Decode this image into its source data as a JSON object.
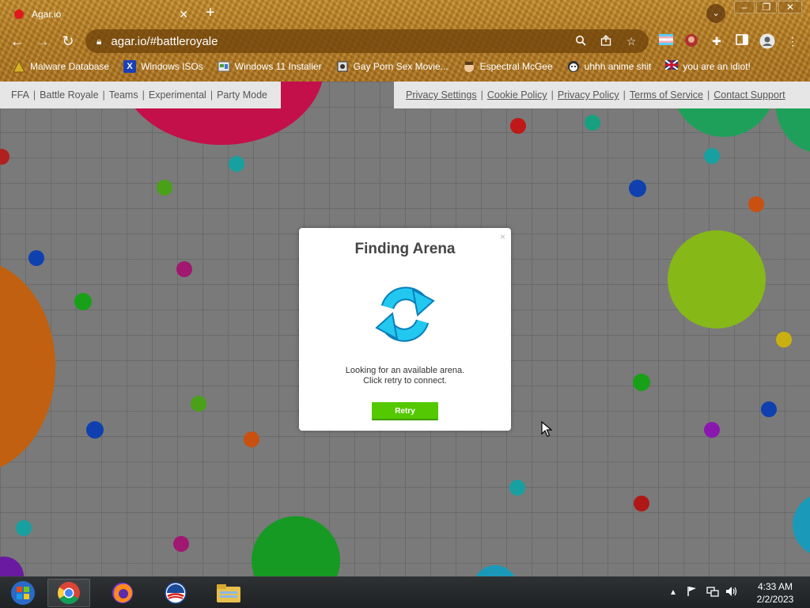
{
  "browser": {
    "tab": {
      "title": "Agar.io",
      "favicon_color": "#e0181e"
    },
    "url": "agar.io/#battleroyale",
    "bookmarks": [
      {
        "label": "Malware Database",
        "icon": "malware-icon"
      },
      {
        "label": "Windows ISOs",
        "icon": "x-icon"
      },
      {
        "label": "Windows 11 Installer",
        "icon": "installer-icon"
      },
      {
        "label": "Gay Porn Sex Movie...",
        "icon": "page-icon"
      },
      {
        "label": "Espectral McGee",
        "icon": "face-icon"
      },
      {
        "label": "uhhh anime shit",
        "icon": "anime-icon"
      },
      {
        "label": "you are an idiot!",
        "icon": "flag-icon"
      }
    ],
    "window_controls": {
      "minimize": "–",
      "restore": "❐",
      "close": "✕"
    }
  },
  "game": {
    "modes": [
      "FFA",
      "Battle Royale",
      "Teams",
      "Experimental",
      "Party Mode"
    ],
    "policy_links": [
      "Privacy Settings",
      "Cookie Policy",
      "Privacy Policy",
      "Terms of Service",
      "Contact Support"
    ]
  },
  "modal": {
    "title": "Finding Arena",
    "close": "×",
    "message_line1": "Looking for an available arena.",
    "message_line2": "Click retry to connect.",
    "retry_label": "Retry",
    "spinner_color": "#22c8f0",
    "button_color": "#54c800"
  },
  "taskbar": {
    "time": "4:33 AM",
    "date": "2/2/2023"
  }
}
